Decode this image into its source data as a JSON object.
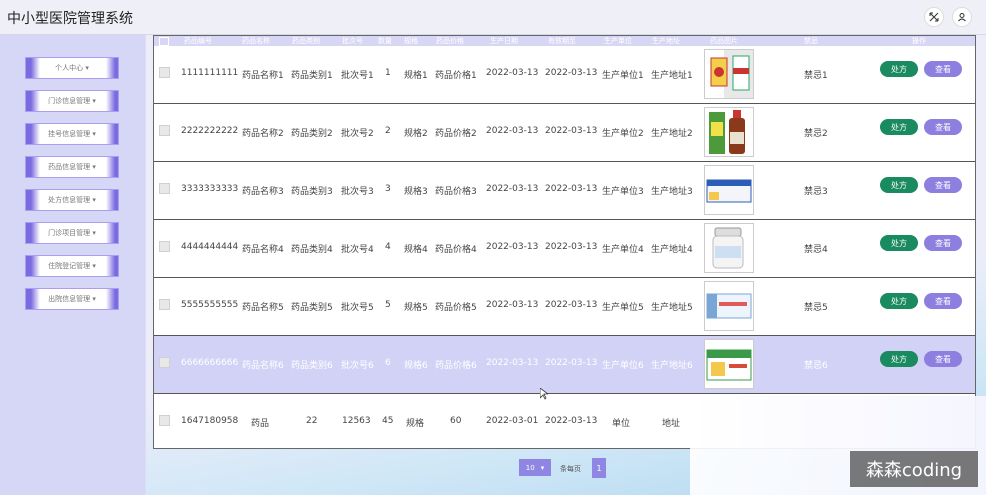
{
  "app": {
    "title": "中小型医院管理系统"
  },
  "sidebar": {
    "items": [
      {
        "label": "个人中心 ▾"
      },
      {
        "label": "门诊信息管理 ▾"
      },
      {
        "label": "挂号信息管理 ▾"
      },
      {
        "label": "药品信息管理 ▾"
      },
      {
        "label": "处方信息管理 ▾"
      },
      {
        "label": "门诊项目管理 ▾"
      },
      {
        "label": "住院登记管理 ▾"
      },
      {
        "label": "出院信息管理 ▾"
      }
    ]
  },
  "table": {
    "headers": [
      "药品编号",
      "药品名称",
      "药品类别",
      "批次号",
      "数量",
      "规格",
      "药品价格",
      "生产日期",
      "有效期至",
      "生产单位",
      "生产地址",
      "药品图片",
      "禁忌",
      "操作"
    ],
    "rows": [
      {
        "id": "1111111111",
        "name": "药品名称1",
        "category": "药品类别1",
        "batch": "批次号1",
        "qty": "1",
        "spec": "规格1",
        "price": "药品价格1",
        "mfg": "2022-03-13",
        "exp": "2022-03-13",
        "unit": "生产单位1",
        "addr": "生产地址1",
        "taboo": "禁忌1",
        "rx": "处方",
        "view": "查看"
      },
      {
        "id": "2222222222",
        "name": "药品名称2",
        "category": "药品类别2",
        "batch": "批次号2",
        "qty": "2",
        "spec": "规格2",
        "price": "药品价格2",
        "mfg": "2022-03-13",
        "exp": "2022-03-13",
        "unit": "生产单位2",
        "addr": "生产地址2",
        "taboo": "禁忌2",
        "rx": "处方",
        "view": "查看"
      },
      {
        "id": "3333333333",
        "name": "药品名称3",
        "category": "药品类别3",
        "batch": "批次号3",
        "qty": "3",
        "spec": "规格3",
        "price": "药品价格3",
        "mfg": "2022-03-13",
        "exp": "2022-03-13",
        "unit": "生产单位3",
        "addr": "生产地址3",
        "taboo": "禁忌3",
        "rx": "处方",
        "view": "查看"
      },
      {
        "id": "4444444444",
        "name": "药品名称4",
        "category": "药品类别4",
        "batch": "批次号4",
        "qty": "4",
        "spec": "规格4",
        "price": "药品价格4",
        "mfg": "2022-03-13",
        "exp": "2022-03-13",
        "unit": "生产单位4",
        "addr": "生产地址4",
        "taboo": "禁忌4",
        "rx": "处方",
        "view": "查看"
      },
      {
        "id": "5555555555",
        "name": "药品名称5",
        "category": "药品类别5",
        "batch": "批次号5",
        "qty": "5",
        "spec": "规格5",
        "price": "药品价格5",
        "mfg": "2022-03-13",
        "exp": "2022-03-13",
        "unit": "生产单位5",
        "addr": "生产地址5",
        "taboo": "禁忌5",
        "rx": "处方",
        "view": "查看"
      },
      {
        "id": "6666666666",
        "name": "药品名称6",
        "category": "药品类别6",
        "batch": "批次号6",
        "qty": "6",
        "spec": "规格6",
        "price": "药品价格6",
        "mfg": "2022-03-13",
        "exp": "2022-03-13",
        "unit": "生产单位6",
        "addr": "生产地址6",
        "taboo": "禁忌6",
        "rx": "处方",
        "view": "查看"
      },
      {
        "id": "1647180958",
        "name": "药品",
        "category": "22",
        "batch": "12563",
        "qty": "45",
        "spec": "规格",
        "price": "60",
        "mfg": "2022-03-01",
        "exp": "2022-03-13",
        "unit": "单位",
        "addr": "地址",
        "taboo": "",
        "rx": "",
        "view": ""
      }
    ]
  },
  "pagination": {
    "page_size": "10",
    "page_size_label": "条每页",
    "current_page": "1"
  },
  "watermark": {
    "text": "森森coding"
  },
  "colors": {
    "accent": "#8c7fe0",
    "rx_button": "#1a8a60",
    "sidebar_bg": "#d6d6f7"
  }
}
